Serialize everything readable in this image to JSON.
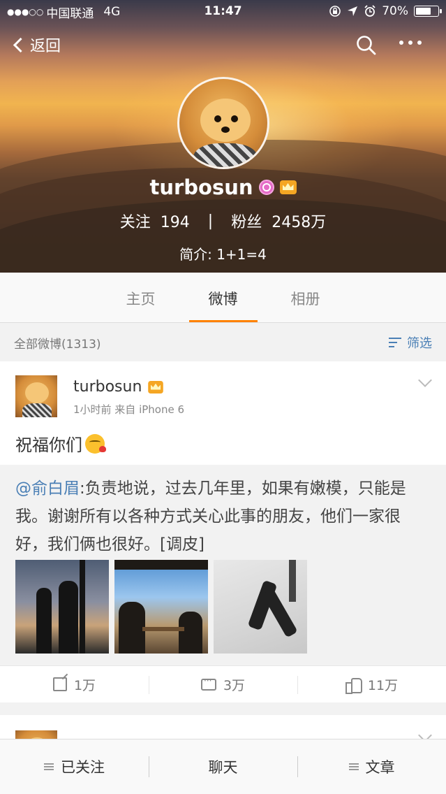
{
  "status_bar": {
    "carrier": "中国联通",
    "network": "4G",
    "time": "11:47",
    "battery": "70%",
    "battery_level": 0.7
  },
  "nav": {
    "back_label": "返回"
  },
  "profile": {
    "username": "turbosun",
    "following_label": "关注",
    "following_count": "194",
    "separator": "|",
    "followers_label": "粉丝",
    "followers_count": "2458万",
    "bio": "简介: 1+1=4"
  },
  "tabs": [
    {
      "label": "主页"
    },
    {
      "label": "微博"
    },
    {
      "label": "相册"
    }
  ],
  "filter_bar": {
    "summary": "全部微博(1313)",
    "filter_label": "筛选"
  },
  "post": {
    "author": "turbosun",
    "meta": "1小时前  来自 iPhone 6",
    "text": "祝福你们",
    "repost": {
      "mention": "@俞白眉",
      "body": ":负责地说，过去几年里，如果有嫩模，只能是我。谢谢所有以各种方式关心此事的朋友，他们一家很好，我们俩也很好。[调皮]"
    },
    "actions": {
      "repost_count": "1万",
      "comment_count": "3万",
      "like_count": "11万"
    }
  },
  "bottom_bar": {
    "follow_label": "已关注",
    "chat_label": "聊天",
    "article_label": "文章"
  },
  "colors": {
    "accent_orange": "#ff8200",
    "link_blue": "#4a7fb5"
  }
}
